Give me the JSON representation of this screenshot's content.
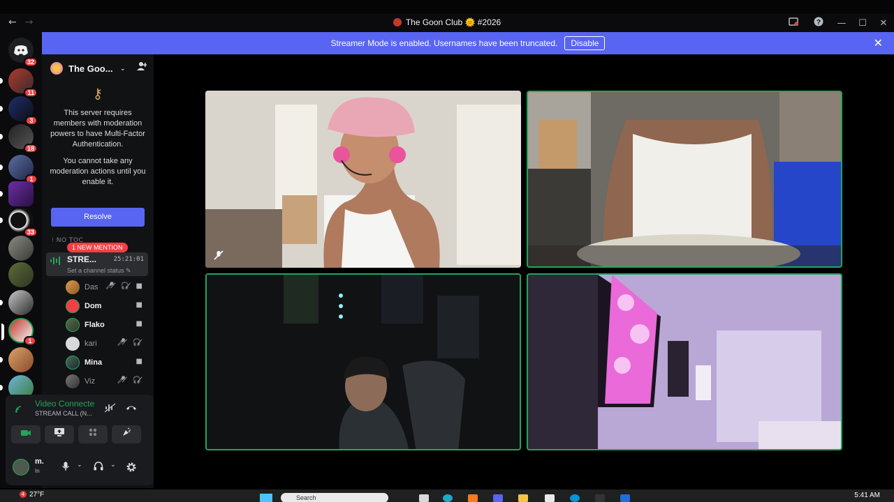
{
  "window": {
    "title": "The Goon Club 🌞 #2026",
    "nav_back": "←",
    "nav_forward": "→",
    "icons": [
      "inbox-icon",
      "help-icon"
    ],
    "win_controls": [
      "—",
      "☐",
      "✕"
    ]
  },
  "guild_rail": {
    "home_badge": "32",
    "badges": [
      "11",
      "3",
      "18",
      "1",
      "33",
      "1"
    ]
  },
  "banner": {
    "text": "Streamer Mode is enabled. Usernames have been truncated.",
    "button": "Disable",
    "close": "✕"
  },
  "server": {
    "name": "The Goo...",
    "chevron": "⌄",
    "invite_icon": "add-person-icon"
  },
  "mfa_notice": {
    "line1": "This server requires members with moderation powers to have Multi-Factor Authentication.",
    "line2": "You cannot take any moderation actions until you enable it.",
    "button": "Resolve"
  },
  "channels": {
    "category_label": "⁝ NO TOC",
    "mention_pill": "1 NEW MENTION",
    "voice_channel": {
      "name": "STRE...",
      "timer": "25:21:01",
      "status": "Set a channel status ✎"
    },
    "voice_users": [
      {
        "name": "Das",
        "icons": "🎤̸ 🎧̸ ■",
        "color": "#949ba4"
      },
      {
        "name": "Dom",
        "icons": "■",
        "color": "#f2f3f5"
      },
      {
        "name": "Flako",
        "icons": "■",
        "color": "#f2f3f5"
      },
      {
        "name": "kari",
        "icons": "🎤̸ 🎧̸",
        "color": "#949ba4"
      },
      {
        "name": "Mina",
        "icons": "■",
        "color": "#f2f3f5"
      },
      {
        "name": "Viz",
        "icons": "🎤̸ 🎧̸",
        "color": "#949ba4"
      }
    ]
  },
  "voice_panel": {
    "title": "Video Connecte",
    "subtitle": "STREAM CALL (N...",
    "user_name": "m.",
    "user_status": "In"
  },
  "taskbar": {
    "weather": "27°F",
    "weather_badge": "4",
    "search_placeholder": "Search",
    "clock": "5:41 AM"
  },
  "colors": {
    "brand": "#5865f2",
    "speaking": "#23a55a",
    "danger": "#f23f43"
  }
}
